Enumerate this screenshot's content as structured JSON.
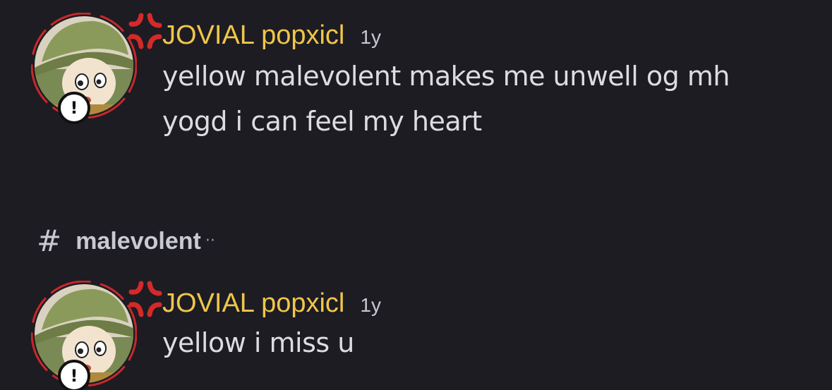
{
  "messages": [
    {
      "username": "JOVIAL popxicl",
      "timestamp": "1y",
      "lines": [
        "yellow malevolent makes me unwell og mh",
        "yogd i can feel my heart"
      ],
      "avatar_icon": "character-avatar-icon",
      "badge_icon": "exclamation-icon",
      "badge_text": "!",
      "decoration_icon": "anger-mark-icon"
    },
    {
      "username": "JOVIAL popxicl",
      "timestamp": "1y",
      "lines": [
        "yellow i miss u"
      ],
      "avatar_icon": "character-avatar-icon",
      "badge_icon": "exclamation-icon",
      "badge_text": "!",
      "decoration_icon": "anger-mark-icon"
    }
  ],
  "channel": {
    "hash": "#",
    "name": "malevolent",
    "dots": "··"
  },
  "colors": {
    "background": "#1c1c22",
    "username": "#f0c64a",
    "message_text": "#dcdce2",
    "timestamp": "#c8c8d0",
    "avatar_ring": "#c8282a"
  }
}
